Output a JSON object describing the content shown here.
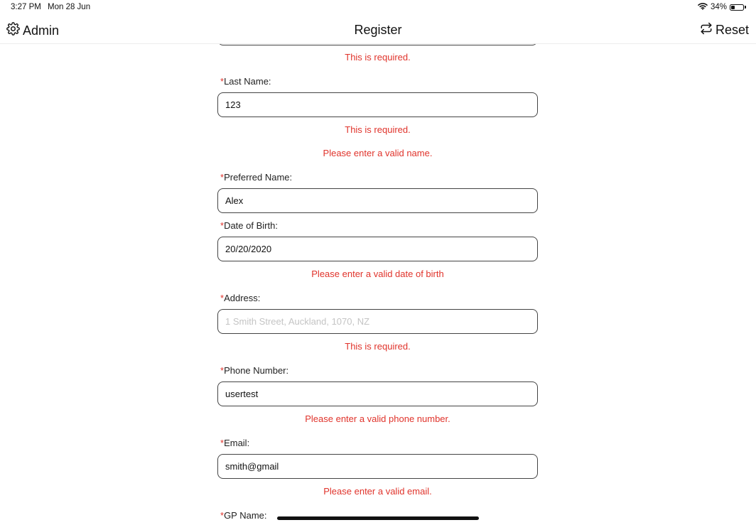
{
  "status_bar": {
    "time": "3:27 PM",
    "date": "Mon 28 Jun",
    "battery": "34%",
    "battery_level": 0.34
  },
  "nav": {
    "left_label": "Admin",
    "title": "Register",
    "right_label": "Reset"
  },
  "form": {
    "required_marker": "*",
    "first_name_error": "This is required.",
    "last_name": {
      "label": "Last Name:",
      "value": "123",
      "errors": [
        "This is required.",
        "Please enter a valid name."
      ]
    },
    "preferred_name": {
      "label": "Preferred Name:",
      "value": "Alex"
    },
    "date_of_birth": {
      "label": "Date of Birth:",
      "value": "20/20/2020",
      "error": "Please enter a valid date of birth"
    },
    "address": {
      "label": "Address:",
      "value": "",
      "placeholder": "1 Smith Street, Auckland, 1070, NZ",
      "error": "This is required."
    },
    "phone_number": {
      "label": "Phone Number:",
      "value": "usertest",
      "error": "Please enter a valid phone number."
    },
    "email": {
      "label": "Email:",
      "value": "smith@gmail",
      "error": "Please enter a valid email."
    },
    "gp_name": {
      "label": "GP Name:"
    }
  }
}
